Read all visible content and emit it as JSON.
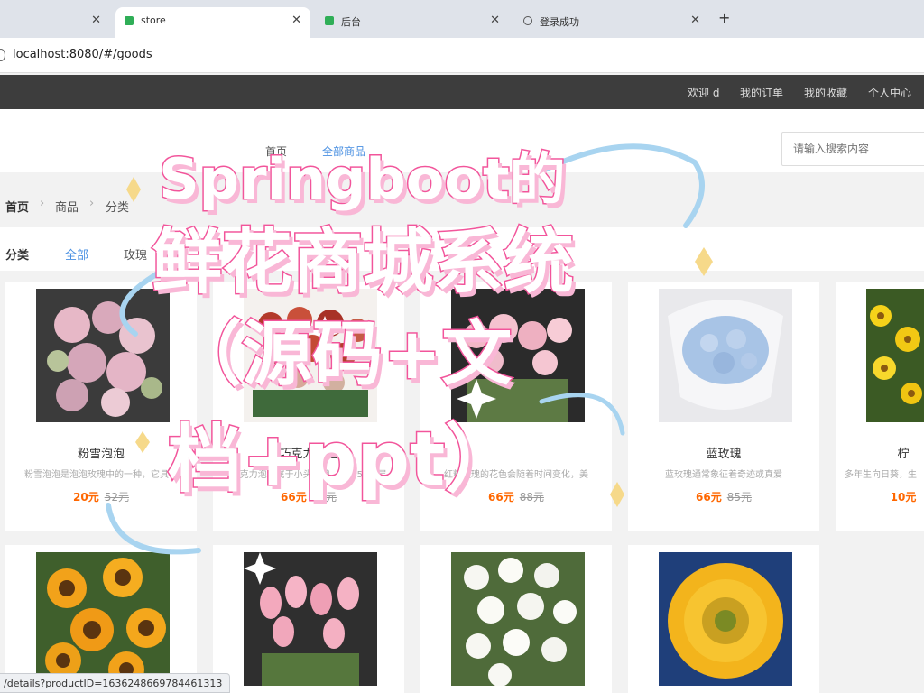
{
  "browser": {
    "tabs": [
      {
        "title": "",
        "active": false
      },
      {
        "title": "store",
        "active": true
      },
      {
        "title": "后台",
        "active": false
      },
      {
        "title": "登录成功",
        "active": false
      }
    ],
    "url": "localhost:8080/#/goods",
    "status_url": "/details?productID=1636248669784461313"
  },
  "topnav": {
    "welcome": "欢迎 d",
    "orders": "我的订单",
    "favorites": "我的收藏",
    "profile": "个人中心"
  },
  "header": {
    "menu": [
      "首页",
      "全部商品"
    ],
    "search_placeholder": "请输入搜索内容"
  },
  "breadcrumb": [
    "首页",
    "商品",
    "分类"
  ],
  "categories": {
    "label": "分类",
    "items": [
      "全部",
      "玫瑰"
    ]
  },
  "products": [
    {
      "name": "粉雪泡泡",
      "desc": "粉雪泡泡是泡泡玫瑰中的一种，它具有",
      "price": "20元",
      "old_price": "52元",
      "img": "pink-spray-rose"
    },
    {
      "name": "巧克力泡泡",
      "desc": "巧克力泡泡属于小头玫瑰，花瓣5到6层",
      "price": "66元",
      "old_price": "66元",
      "img": "red-spray-rose"
    },
    {
      "name": "",
      "desc": "红粉玫瑰的花色会随着时间变化，美",
      "price": "66元",
      "old_price": "88元",
      "img": "pink-rose"
    },
    {
      "name": "蓝玫瑰",
      "desc": "蓝玫瑰通常象征着奇迹或真爱",
      "price": "66元",
      "old_price": "85元",
      "img": "blue-rose-bouquet"
    },
    {
      "name": "柠",
      "desc": "多年生向日葵，生",
      "price": "10元",
      "old_price": "",
      "img": "yellow-daisy"
    },
    {
      "name": "",
      "desc": "",
      "price": "",
      "old_price": "",
      "img": "sunflower-bunch"
    },
    {
      "name": "",
      "desc": "",
      "price": "",
      "old_price": "",
      "img": "pink-tulip"
    },
    {
      "name": "",
      "desc": "",
      "price": "",
      "old_price": "",
      "img": "white-rose"
    },
    {
      "name": "",
      "desc": "",
      "price": "",
      "old_price": "",
      "img": "teddy-sunflower"
    }
  ],
  "overlay": {
    "line1": "Springboot的",
    "line2": "鲜花商城系统",
    "line3": "（源码+文",
    "line4": "档+ppt）"
  }
}
